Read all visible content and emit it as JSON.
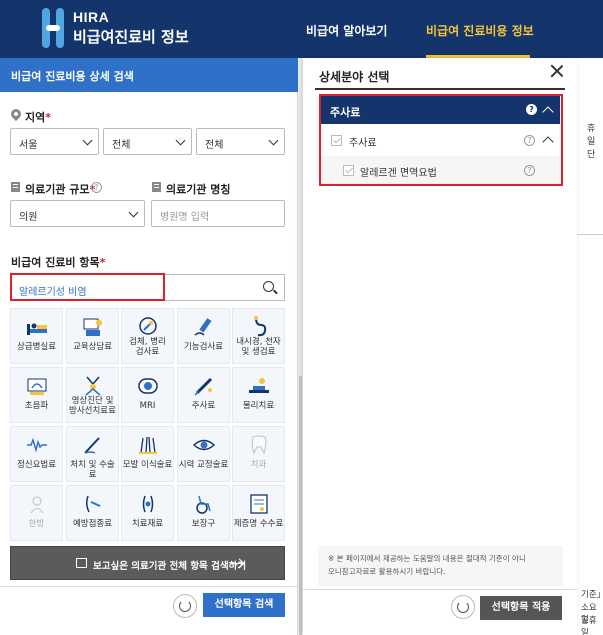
{
  "header": {
    "brand_en": "HIRA",
    "brand_ko": "비급여진료비 정보",
    "nav": [
      {
        "label": "비급여 알아보기"
      },
      {
        "label": "비급여 진료비용 정보"
      }
    ],
    "accent": "#f6c33b",
    "bg": "#14356b"
  },
  "left": {
    "title": "비급여 진료비용 상세 검색",
    "region": {
      "label": "지역",
      "selects": [
        "서울",
        "전체",
        "전체"
      ]
    },
    "scale": {
      "label": "의료기관 규모",
      "value": "의원"
    },
    "inst_name": {
      "label": "의료기관 명칭",
      "placeholder": "병원명 입력"
    },
    "items": {
      "label": "비급여 진료비 항목",
      "search_value": "알레르기성 비염"
    },
    "categories": [
      {
        "label": "상급병실료",
        "icon": "hospital-bed-icon"
      },
      {
        "label": "교육상담료",
        "icon": "consultation-icon"
      },
      {
        "label": "검체, 병리\n검사료",
        "icon": "microscope-icon"
      },
      {
        "label": "기능검사료",
        "icon": "test-tube-icon"
      },
      {
        "label": "내시경, 천자\n및 생검료",
        "icon": "endoscope-icon"
      },
      {
        "label": "초음파",
        "icon": "ultrasound-icon"
      },
      {
        "label": "영상진단 및\n방사선치료료",
        "icon": "radiation-icon"
      },
      {
        "label": "MRI",
        "icon": "mri-icon"
      },
      {
        "label": "주사료",
        "icon": "syringe-icon"
      },
      {
        "label": "물리치료",
        "icon": "physical-therapy-icon"
      },
      {
        "label": "정신요법료",
        "icon": "brainwave-icon"
      },
      {
        "label": "처치 및 수술료",
        "icon": "scalpel-icon"
      },
      {
        "label": "모발 이식술료",
        "icon": "hair-icon"
      },
      {
        "label": "시력 교정술료",
        "icon": "eye-icon"
      },
      {
        "label": "치과",
        "icon": "tooth-icon",
        "disabled": true
      },
      {
        "label": "한방",
        "icon": "herbal-icon",
        "disabled": true
      },
      {
        "label": "예방접종료",
        "icon": "vaccine-icon"
      },
      {
        "label": "치료재료",
        "icon": "medical-material-icon"
      },
      {
        "label": "보장구",
        "icon": "wheelchair-icon"
      },
      {
        "label": "제증명 수수료",
        "icon": "certificate-icon"
      }
    ],
    "btn_all": "보고싶은 의료기관 전체 항목 검색하기",
    "btn_search": "선택항목 검색"
  },
  "modal": {
    "title": "상세분야 선택",
    "group": "주사료",
    "sub": "주사료",
    "item": "알레르겐 면역요법",
    "note_line1": "※ 본 페이지에서 제공하는 도움말의 내용은 절대적 기준이 아니",
    "note_line2": "오니참고자료로 활용하시기 바랍니다.",
    "btn_apply": "선택항목 적용"
  },
  "background": {
    "side_text": "휴일단",
    "lines": [
      "기준」",
      "소요일",
      "공휴일"
    ]
  }
}
